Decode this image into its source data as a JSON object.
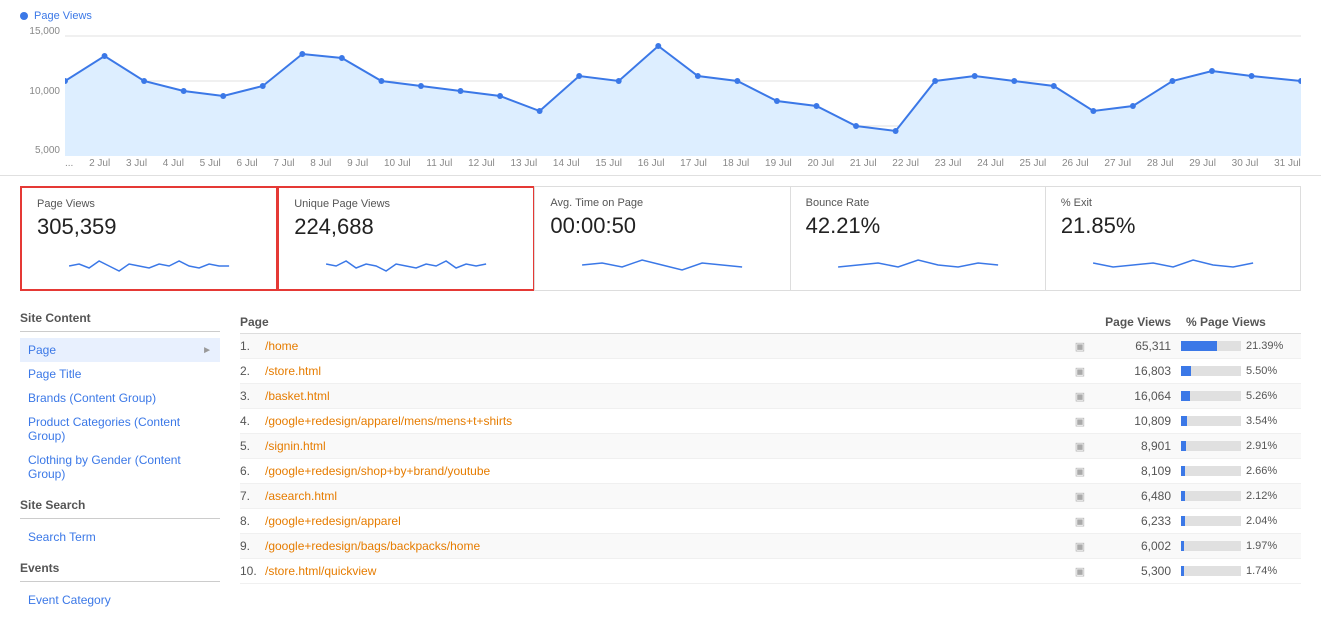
{
  "chart": {
    "legend": "Page Views",
    "y_labels": [
      "15,000",
      "10,000",
      "5,000"
    ],
    "x_labels": [
      "...",
      "2 Jul",
      "3 Jul",
      "4 Jul",
      "5 Jul",
      "6 Jul",
      "7 Jul",
      "8 Jul",
      "9 Jul",
      "10 Jul",
      "11 Jul",
      "12 Jul",
      "13 Jul",
      "14 Jul",
      "15 Jul",
      "16 Jul",
      "17 Jul",
      "18 Jul",
      "19 Jul",
      "20 Jul",
      "21 Jul",
      "22 Jul",
      "23 Jul",
      "24 Jul",
      "25 Jul",
      "26 Jul",
      "27 Jul",
      "28 Jul",
      "29 Jul",
      "30 Jul",
      "31 Jul"
    ]
  },
  "metrics": [
    {
      "label": "Page Views",
      "value": "305,359",
      "highlighted": true
    },
    {
      "label": "Unique Page Views",
      "value": "224,688",
      "highlighted": true
    },
    {
      "label": "Avg. Time on Page",
      "value": "00:00:50",
      "highlighted": false
    },
    {
      "label": "Bounce Rate",
      "value": "42.21%",
      "highlighted": false
    },
    {
      "label": "% Exit",
      "value": "21.85%",
      "highlighted": false
    }
  ],
  "sidebar": {
    "sections": [
      {
        "title": "Site Content",
        "items": [
          {
            "label": "Page",
            "active": true,
            "arrow": true
          },
          {
            "label": "Page Title",
            "active": false,
            "arrow": false
          },
          {
            "label": "Brands (Content Group)",
            "active": false,
            "arrow": false
          },
          {
            "label": "Product Categories (Content Group)",
            "active": false,
            "arrow": false
          },
          {
            "label": "Clothing by Gender (Content Group)",
            "active": false,
            "arrow": false
          }
        ]
      },
      {
        "title": "Site Search",
        "items": [
          {
            "label": "Search Term",
            "active": false,
            "arrow": false
          }
        ]
      },
      {
        "title": "Events",
        "items": [
          {
            "label": "Event Category",
            "active": false,
            "arrow": false
          }
        ]
      }
    ]
  },
  "table": {
    "col_page": "Page",
    "col_pageviews": "Page Views",
    "col_pctviews": "% Page Views",
    "rows": [
      {
        "num": "1.",
        "page": "/home",
        "views": "65,311",
        "pct": "21.39%",
        "bar": 100
      },
      {
        "num": "2.",
        "page": "/store.html",
        "views": "16,803",
        "pct": "5.50%",
        "bar": 26
      },
      {
        "num": "3.",
        "page": "/basket.html",
        "views": "16,064",
        "pct": "5.26%",
        "bar": 25
      },
      {
        "num": "4.",
        "page": "/google+redesign/apparel/mens/mens+t+shirts",
        "views": "10,809",
        "pct": "3.54%",
        "bar": 17
      },
      {
        "num": "5.",
        "page": "/signin.html",
        "views": "8,901",
        "pct": "2.91%",
        "bar": 14
      },
      {
        "num": "6.",
        "page": "/google+redesign/shop+by+brand/youtube",
        "views": "8,109",
        "pct": "2.66%",
        "bar": 12
      },
      {
        "num": "7.",
        "page": "/asearch.html",
        "views": "6,480",
        "pct": "2.12%",
        "bar": 10
      },
      {
        "num": "8.",
        "page": "/google+redesign/apparel",
        "views": "6,233",
        "pct": "2.04%",
        "bar": 10
      },
      {
        "num": "9.",
        "page": "/google+redesign/bags/backpacks/home",
        "views": "6,002",
        "pct": "1.97%",
        "bar": 9
      },
      {
        "num": "10.",
        "page": "/store.html/quickview",
        "views": "5,300",
        "pct": "1.74%",
        "bar": 8
      }
    ]
  }
}
